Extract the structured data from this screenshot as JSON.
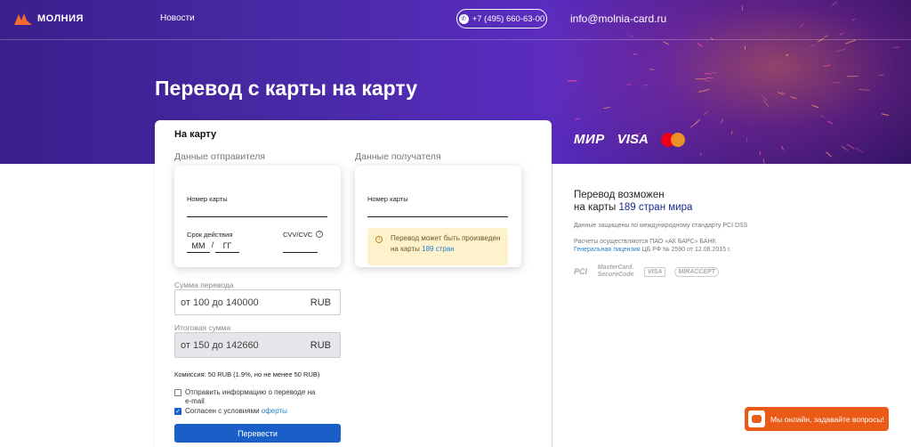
{
  "header": {
    "logo_text": "МОЛНИЯ",
    "nav_news": "Новости",
    "phone": "+7 (495) 660-63-00",
    "email": "info@molnia-card.ru"
  },
  "page_title": "Перевод с карты на карту",
  "form": {
    "tab_label": "На карту",
    "sender_section": "Данные отправителя",
    "recipient_section": "Данные получателя",
    "sender": {
      "card_number_label": "Номер карты",
      "expiry_label": "Срок действия",
      "expiry_month_placeholder": "ММ",
      "expiry_separator": "/",
      "expiry_year_placeholder": "ГГ",
      "cvv_label": "CVV/CVC"
    },
    "recipient": {
      "card_number_label": "Номер карты",
      "notice_text": "Перевод может быть произведен на карты ",
      "notice_link": "189 стран"
    },
    "amount_label": "Сумма перевода",
    "amount_placeholder": "от 100 до 140000",
    "amount_currency": "RUB",
    "total_label": "Итоговая сумма",
    "total_placeholder": "от 150 до 142660",
    "total_currency": "RUB",
    "fee_text": "Комиссия: 50 RUB (1.9%, но не менее 50 RUB)",
    "send_info_label": "Отправить информацию о переводе на e-mail",
    "agree_text": "Согласен с условиями ",
    "agree_link": "оферты",
    "submit_label": "Перевести"
  },
  "payment_systems": [
    "МИР",
    "VISA",
    "mastercard"
  ],
  "info": {
    "title_line1": "Перевод возможен",
    "title_line2_prefix": "на карты ",
    "title_line2_highlight": "189 стран мира",
    "security_text": "Данные защищены по международному стандарту PCI DSS",
    "bank_text": "Расчеты осуществляются ПАО «АК БАРС» БАНК",
    "license_link": "Генеральная лицензия",
    "license_text": " ЦБ РФ № 2590 от 12.08.2015 г."
  },
  "security_logos": [
    "PCI",
    "MasterCard. SecureCode",
    "VISA",
    "MIRACCEPT"
  ],
  "chat": {
    "label": "Мы онлайн, задавайте вопросы!"
  },
  "colors": {
    "accent": "#1a5fc8",
    "brand_orange": "#e95b17",
    "hero_purple": "#4a2aa8"
  }
}
